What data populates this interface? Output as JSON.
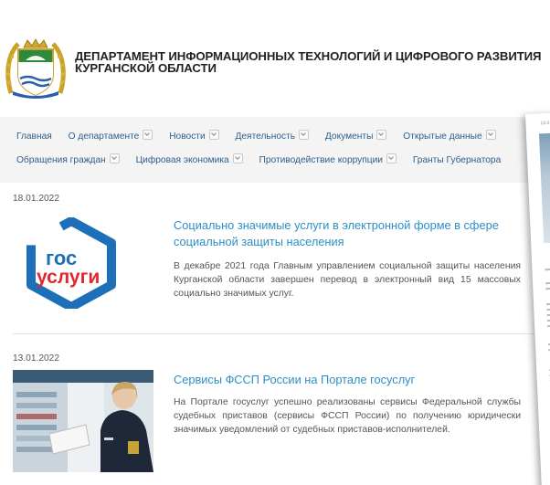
{
  "header": {
    "title_line1": "ДЕПАРТАМЕНТ ИНФОРМАЦИОННЫХ ТЕХНОЛОГИЙ И ЦИФРОВОГО РАЗВИТИЯ",
    "title_line2": "КУРГАНСКОЙ ОБЛАСТИ"
  },
  "nav": {
    "row1": [
      {
        "label": "Главная",
        "dropdown": false
      },
      {
        "label": "О департаменте",
        "dropdown": true
      },
      {
        "label": "Новости",
        "dropdown": true
      },
      {
        "label": "Деятельность",
        "dropdown": true
      },
      {
        "label": "Документы",
        "dropdown": true
      },
      {
        "label": "Открытые данные",
        "dropdown": true
      }
    ],
    "row2": [
      {
        "label": "Обращения граждан",
        "dropdown": true
      },
      {
        "label": "Цифровая экономика",
        "dropdown": true
      },
      {
        "label": "Противодействие коррупции",
        "dropdown": true
      },
      {
        "label": "Гранты Губернатора",
        "dropdown": false
      }
    ]
  },
  "news": [
    {
      "date": "18.01.2022",
      "title": "Социально значимые услуги в электронной форме в сфере социальной защиты населения",
      "text": "В декабре 2021 года Главным управлением социальной защиты населения Курганской области завершен перевод в электронный вид 15 массовых социально значимых услуг.",
      "logo_text_line1": "гос",
      "logo_text_line2": "услуги"
    },
    {
      "date": "13.01.2022",
      "title": "Сервисы ФССП России на Портале госуслуг",
      "text": "На Портале госуслуг успешно реализованы сервисы Федеральной службы судебных приставов (сервисы ФССП России) по получению юридически значимых уведомлений от судебных приставов-исполнителей."
    }
  ],
  "overlay": {
    "date": "13.0"
  },
  "colors": {
    "link": "#2d8fc6",
    "nav_link": "#2e5e8c",
    "gos_blue": "#1c6fb8",
    "gos_red": "#e1262c"
  }
}
